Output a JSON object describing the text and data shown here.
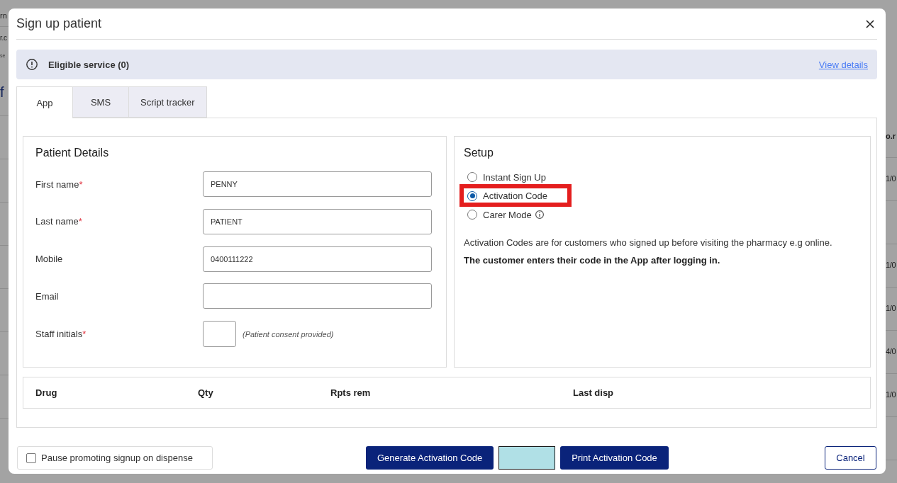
{
  "background": {
    "left": [
      {
        "kind": "text",
        "text": "rn"
      },
      {
        "kind": "subtext",
        "text": "r.c"
      },
      {
        "kind": "caption",
        "text": "se"
      },
      {
        "kind": "heading",
        "text": "f"
      }
    ],
    "right_header": "o.r",
    "right_rows": [
      {
        "kind": "value",
        "text": "1/0"
      },
      {
        "kind": "blank"
      },
      {
        "kind": "value",
        "text": "1/0"
      },
      {
        "kind": "value",
        "text": "1/0"
      },
      {
        "kind": "value",
        "text": "4/0"
      },
      {
        "kind": "value",
        "text": "1/0"
      },
      {
        "kind": "blank"
      }
    ]
  },
  "dialog": {
    "title": "Sign up patient"
  },
  "notice": {
    "text": "Eligible service (0)",
    "link": "View details"
  },
  "tabs": [
    {
      "label": "App",
      "selected": true
    },
    {
      "label": "SMS",
      "selected": false
    },
    {
      "label": "Script tracker",
      "selected": false
    }
  ],
  "patient_details": {
    "title": "Patient Details",
    "fields": [
      {
        "kind": "text",
        "label": "First name",
        "required_mark": "*",
        "value": "PENNY"
      },
      {
        "kind": "text",
        "label": "Last name",
        "required_mark": "*",
        "value": "PATIENT"
      },
      {
        "kind": "text",
        "label": "Mobile",
        "value": "0400111222"
      },
      {
        "kind": "text",
        "label": "Email"
      },
      {
        "kind": "initials",
        "label": "Staff initials",
        "required_mark": "*",
        "hint": "(Patient consent provided)"
      }
    ]
  },
  "setup": {
    "title": "Setup",
    "options": [
      {
        "label": "Instant Sign Up",
        "selected": false,
        "highlighted": false
      },
      {
        "label": "Activation Code",
        "selected": true,
        "highlighted": true
      },
      {
        "label": "Carer Mode",
        "selected": false,
        "highlighted": false,
        "info": true
      }
    ],
    "description": "Activation Codes are for customers who signed up before visiting the pharmacy e.g online.",
    "note": "The customer enters their code in the App after logging in."
  },
  "drug_table": {
    "columns": [
      "Drug",
      "Qty",
      "Rpts rem",
      "Last disp"
    ]
  },
  "footer": {
    "pause_checkbox": {
      "label": "Pause promoting signup on dispense",
      "checked": false
    },
    "buttons": [
      {
        "kind": "primary",
        "label": "Generate Activation Code"
      },
      {
        "kind": "code_field"
      },
      {
        "kind": "primary",
        "label": "Print Activation Code"
      }
    ],
    "cancel": "Cancel"
  }
}
